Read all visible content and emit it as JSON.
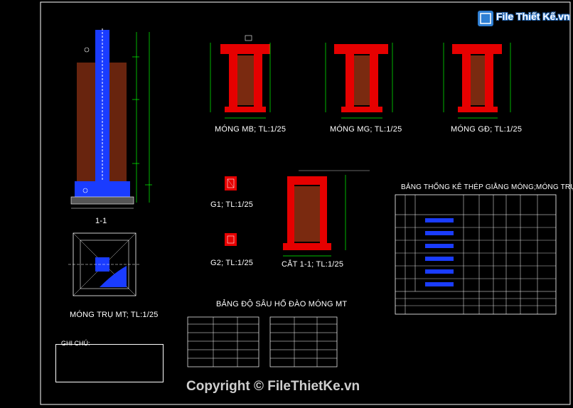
{
  "brand": {
    "name": "File Thiết Kế.vn"
  },
  "copyright": "Copyright © FileThietKe.vn",
  "drawing_titles": {
    "section_1_1": "1-1",
    "mong_tru_mt": "MÓNG TRỤ MT; TL:1/25",
    "mong_mb": "MÓNG MB; TL:1/25",
    "mong_mg": "MÓNG MG; TL:1/25",
    "mong_gd": "MÓNG GĐ; TL:1/25",
    "g1": "G1; TL:1/25",
    "g2": "G2; TL:1/25",
    "cat_1_1": "CẮT 1-1; TL:1/25",
    "bang_do_sau": "BẢNG ĐỘ SÂU HỐ ĐÀO MÓNG MT",
    "bang_thong_ke": "BẢNG THỐNG KÊ THÉP GIẰNG MÓNG;MÓNG TRỤ",
    "ghi_chu": "GHI CHÚ:"
  },
  "colors": {
    "background": "#000000",
    "concrete_red": "#e60000",
    "rebar_blue": "#1a3cff",
    "dimension_green": "#00ff00",
    "brick_brown": "#7a2a10",
    "line_white": "#ffffff"
  }
}
